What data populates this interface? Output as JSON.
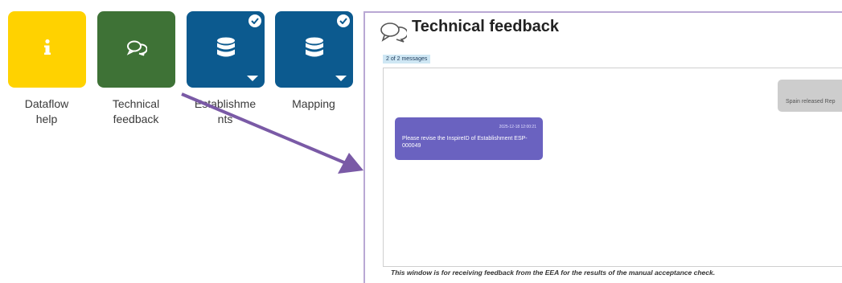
{
  "tiles": [
    {
      "label": "Dataflow\nhelp",
      "icon": "info-icon",
      "color": "#ffd200"
    },
    {
      "label": "Technical\nfeedback",
      "icon": "chat-bubbles-icon",
      "color": "#3e7236"
    },
    {
      "label": "Establishme\nnts",
      "icon": "database-icon",
      "color": "#0c5a8f"
    },
    {
      "label": "Mapping",
      "icon": "database-icon",
      "color": "#0c5a8f"
    }
  ],
  "panel": {
    "title": "Technical feedback",
    "counter": "2 of 2 messages",
    "message_right": "Spain released Rep",
    "message_left": {
      "timestamp": "2025-12-18 12:00:21",
      "text": "Please revise the InspireID of Establishment ESP-000049"
    },
    "footnote": "This window is for receiving feedback from the EEA for the results of the manual acceptance check."
  },
  "colors": {
    "arrow": "#7a5aa6",
    "panel_border": "#b9a8d4",
    "bubble_left": "#6a62c0"
  }
}
